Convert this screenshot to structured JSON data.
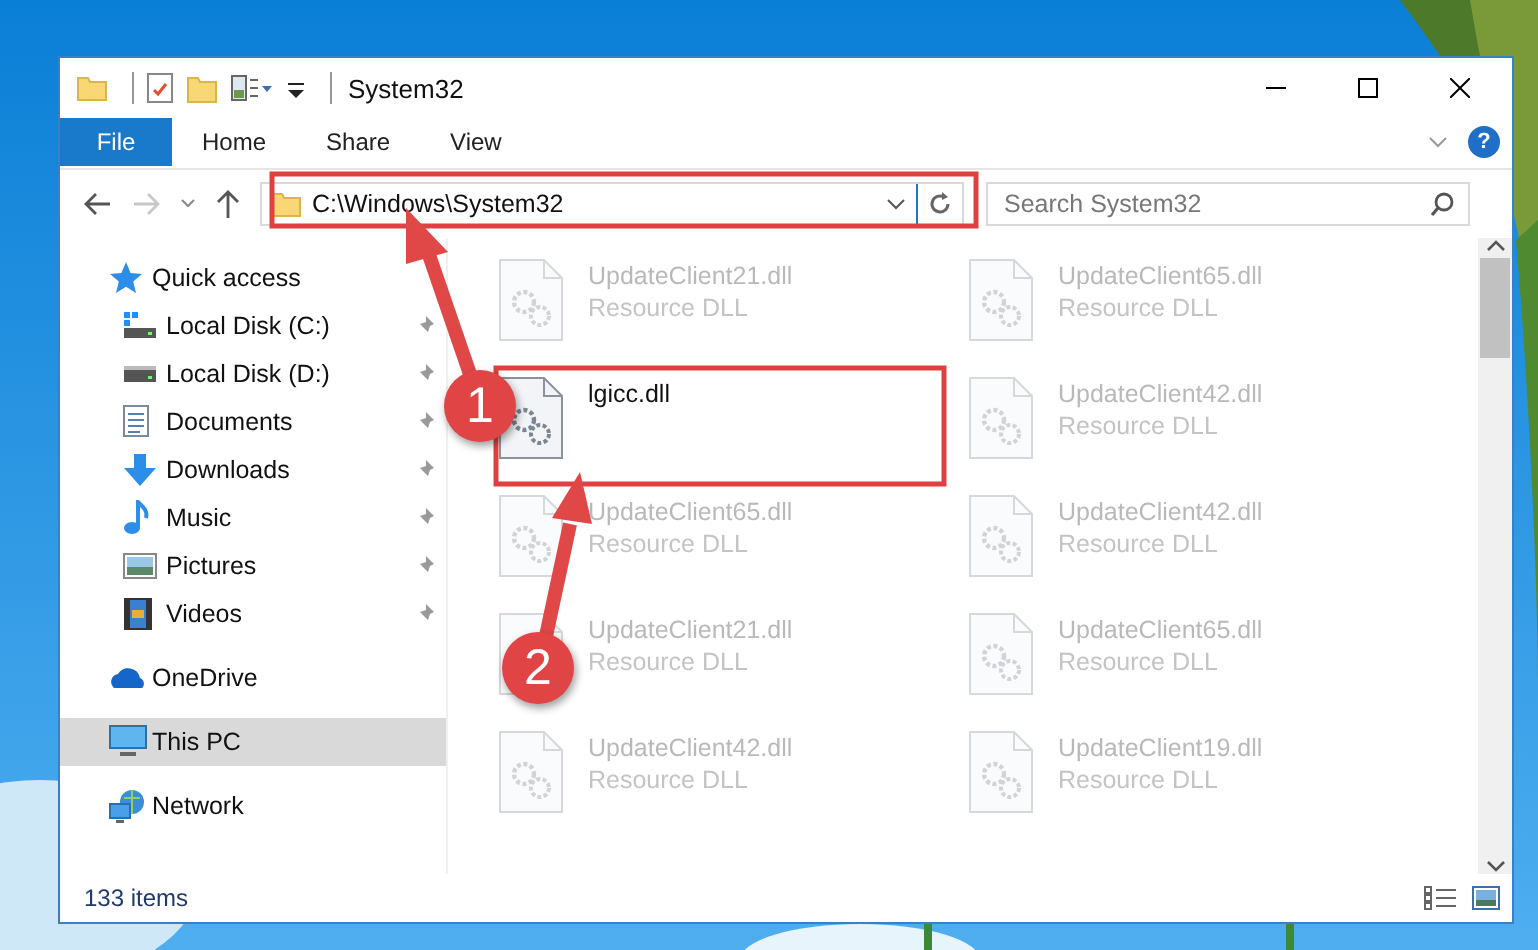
{
  "window": {
    "title": "System32"
  },
  "ribbon": {
    "tabs": [
      {
        "label": "File",
        "kind": "file"
      },
      {
        "label": "Home",
        "kind": "tab"
      },
      {
        "label": "Share",
        "kind": "tab"
      },
      {
        "label": "View",
        "kind": "tab"
      }
    ],
    "help": "?"
  },
  "address_bar": {
    "path": "C:\\Windows\\System32"
  },
  "search": {
    "placeholder": "Search System32"
  },
  "navigation": [
    {
      "label": "Quick access",
      "selected": false,
      "children": [
        {
          "label": "Local Disk (C:)",
          "selected": false,
          "pinned": true
        },
        {
          "label": "Local Disk (D:)",
          "selected": false,
          "pinned": true
        },
        {
          "label": "Documents",
          "selected": false,
          "pinned": true
        },
        {
          "label": "Downloads",
          "selected": false,
          "pinned": true
        },
        {
          "label": "Music",
          "selected": false,
          "pinned": true
        },
        {
          "label": "Pictures",
          "selected": false,
          "pinned": true
        },
        {
          "label": "Videos",
          "selected": false,
          "pinned": true
        }
      ]
    },
    {
      "label": "OneDrive",
      "selected": false
    },
    {
      "label": "This PC",
      "selected": true
    },
    {
      "label": "Network",
      "selected": false
    }
  ],
  "files": [
    {
      "name": "UpdateClient21.dll",
      "type": "Resource DLL",
      "blurred": true
    },
    {
      "name": "UpdateClient65.dll",
      "type": "Resource DLL",
      "blurred": true
    },
    {
      "name": "lgicc.dll",
      "blurred": false
    },
    {
      "name": "UpdateClient42.dll",
      "type": "Resource DLL",
      "blurred": true
    },
    {
      "name": "UpdateClient65.dll",
      "type": "Resource DLL",
      "blurred": true
    },
    {
      "name": "UpdateClient42.dll",
      "type": "Resource DLL",
      "blurred": true
    },
    {
      "name": "UpdateClient21.dll",
      "type": "Resource DLL",
      "blurred": true
    },
    {
      "name": "UpdateClient65.dll",
      "type": "Resource DLL",
      "blurred": true
    },
    {
      "name": "UpdateClient42.dll",
      "type": "Resource DLL",
      "blurred": true
    },
    {
      "name": "UpdateClient19.dll",
      "type": "Resource DLL",
      "blurred": true
    }
  ],
  "status_bar": {
    "item_count": "133 items"
  },
  "annotations": [
    {
      "label": "1"
    },
    {
      "label": "2"
    }
  ]
}
